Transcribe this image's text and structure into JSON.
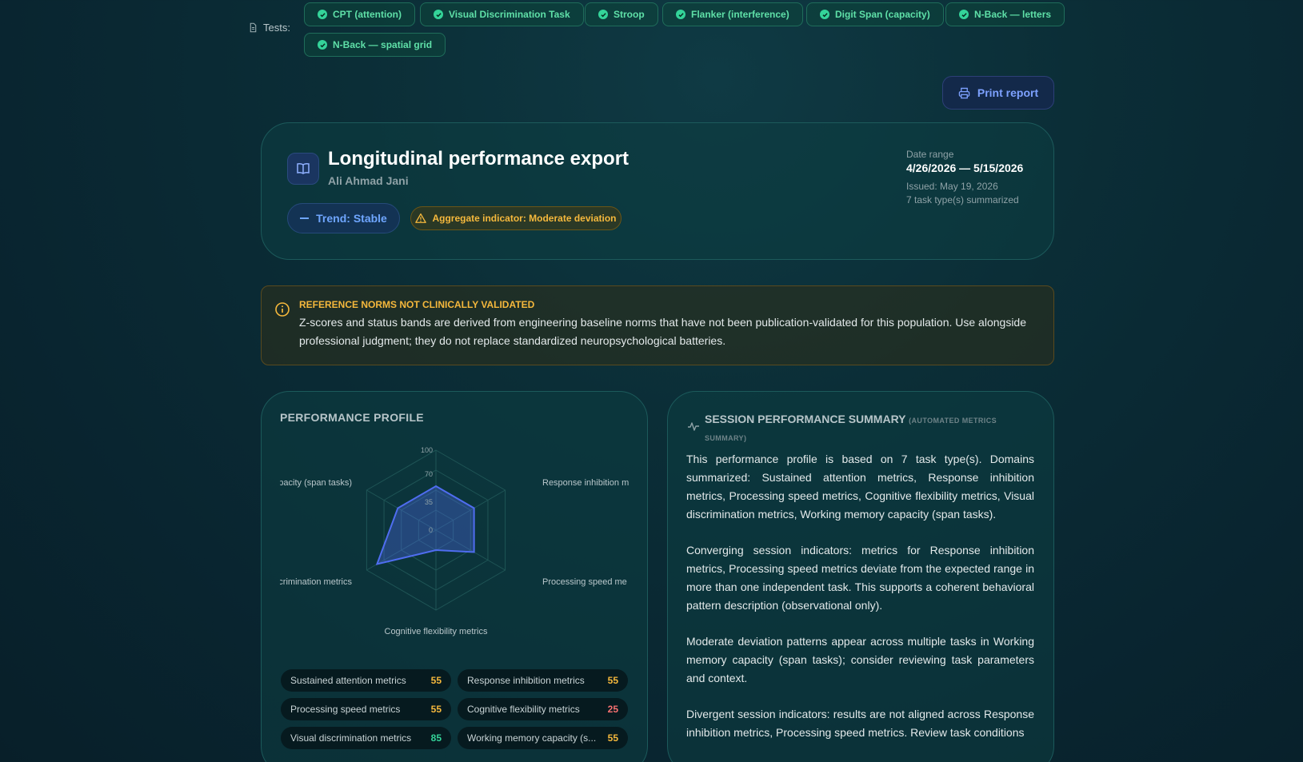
{
  "tests": {
    "label": "Tests:",
    "chips": [
      {
        "label": "CPT (attention)"
      },
      {
        "label": "Visual Discrimination Task"
      },
      {
        "label": "Stroop"
      },
      {
        "label": "Flanker (interference)"
      },
      {
        "label": "Digit Span (capacity)"
      },
      {
        "label": "N-Back — letters"
      },
      {
        "label": "N-Back — spatial grid"
      }
    ]
  },
  "toolbar": {
    "print_label": "Print report"
  },
  "header": {
    "title": "Longitudinal performance export",
    "author": "Ali Ahmad Jani",
    "trend": "Trend: Stable",
    "aggregate": "Aggregate indicator: Moderate deviation",
    "date_range_label": "Date range",
    "date_range": "4/26/2026 — 5/15/2026",
    "issued": "Issued: May 19, 2026",
    "task_count": "7 task type(s) summarized"
  },
  "disclaimer": {
    "title": "REFERENCE NORMS NOT CLINICALLY VALIDATED",
    "body": "Z-scores and status bands are derived from engineering baseline norms that have not been publication-validated for this population. Use alongside professional judgment; they do not replace standardized neuropsychological batteries."
  },
  "profile": {
    "title": "PERFORMANCE PROFILE",
    "scores": [
      {
        "label": "Sustained attention metrics",
        "value": "55",
        "color": "#f5b83c"
      },
      {
        "label": "Response inhibition metrics",
        "value": "55",
        "color": "#f5b83c"
      },
      {
        "label": "Processing speed metrics",
        "value": "55",
        "color": "#f5b83c"
      },
      {
        "label": "Cognitive flexibility metrics",
        "value": "25",
        "color": "#f87171"
      },
      {
        "label": "Visual discrimination metrics",
        "value": "85",
        "color": "#34d399"
      },
      {
        "label": "Working memory capacity (s...",
        "value": "55",
        "color": "#f5b83c"
      }
    ]
  },
  "chart_data": {
    "type": "radar",
    "categories": [
      "Sustained attention metrics",
      "Response inhibition m",
      "Processing speed me",
      "Cognitive flexibility metrics",
      "iscrimination metrics",
      "apacity (span tasks)"
    ],
    "values": [
      55,
      55,
      55,
      25,
      85,
      55
    ],
    "ticks": [
      "0",
      "35",
      "70",
      "100"
    ],
    "range": [
      0,
      100
    ],
    "color": "#4f6df0"
  },
  "summary": {
    "title": "SESSION PERFORMANCE SUMMARY",
    "subtitle": "(AUTOMATED METRICS SUMMARY)",
    "paragraphs": [
      "This performance profile is based on 7 task type(s). Domains summarized: Sustained attention metrics, Response inhibition metrics, Processing speed metrics, Cognitive flexibility metrics, Visual discrimination metrics, Working memory capacity (span tasks).",
      "Converging session indicators: metrics for Response inhibition metrics, Processing speed metrics deviate from the expected range in more than one independent task. This supports a coherent behavioral pattern description (observational only).",
      "Moderate deviation patterns appear across multiple tasks in Working memory capacity (span tasks); consider reviewing task parameters and context.",
      "Divergent session indicators: results are not aligned across Response inhibition metrics, Processing speed metrics. Review task conditions"
    ]
  }
}
